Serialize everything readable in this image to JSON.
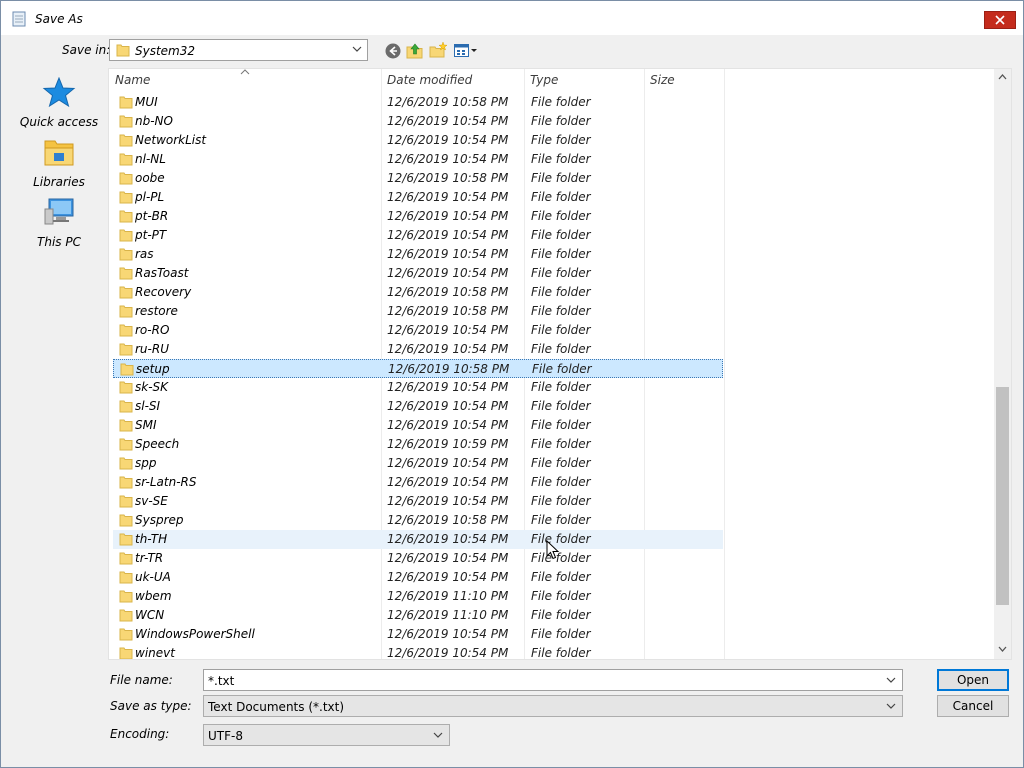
{
  "window": {
    "title": "Save As"
  },
  "save_in": {
    "label": "Save in:",
    "value": "System32"
  },
  "places": [
    {
      "label": "Quick access",
      "icon": "star-icon"
    },
    {
      "label": "Libraries",
      "icon": "libraries-icon"
    },
    {
      "label": "This PC",
      "icon": "computer-icon"
    }
  ],
  "columns": {
    "name": "Name",
    "date": "Date modified",
    "type": "Type",
    "size": "Size"
  },
  "files": [
    {
      "name": "MUI",
      "date": "12/6/2019 10:58 PM",
      "type": "File folder"
    },
    {
      "name": "nb-NO",
      "date": "12/6/2019 10:54 PM",
      "type": "File folder"
    },
    {
      "name": "NetworkList",
      "date": "12/6/2019 10:54 PM",
      "type": "File folder"
    },
    {
      "name": "nl-NL",
      "date": "12/6/2019 10:54 PM",
      "type": "File folder"
    },
    {
      "name": "oobe",
      "date": "12/6/2019 10:58 PM",
      "type": "File folder"
    },
    {
      "name": "pl-PL",
      "date": "12/6/2019 10:54 PM",
      "type": "File folder"
    },
    {
      "name": "pt-BR",
      "date": "12/6/2019 10:54 PM",
      "type": "File folder"
    },
    {
      "name": "pt-PT",
      "date": "12/6/2019 10:54 PM",
      "type": "File folder"
    },
    {
      "name": "ras",
      "date": "12/6/2019 10:54 PM",
      "type": "File folder"
    },
    {
      "name": "RasToast",
      "date": "12/6/2019 10:54 PM",
      "type": "File folder"
    },
    {
      "name": "Recovery",
      "date": "12/6/2019 10:58 PM",
      "type": "File folder"
    },
    {
      "name": "restore",
      "date": "12/6/2019 10:58 PM",
      "type": "File folder"
    },
    {
      "name": "ro-RO",
      "date": "12/6/2019 10:54 PM",
      "type": "File folder"
    },
    {
      "name": "ru-RU",
      "date": "12/6/2019 10:54 PM",
      "type": "File folder"
    },
    {
      "name": "setup",
      "date": "12/6/2019 10:58 PM",
      "type": "File folder"
    },
    {
      "name": "sk-SK",
      "date": "12/6/2019 10:54 PM",
      "type": "File folder"
    },
    {
      "name": "sl-SI",
      "date": "12/6/2019 10:54 PM",
      "type": "File folder"
    },
    {
      "name": "SMI",
      "date": "12/6/2019 10:54 PM",
      "type": "File folder"
    },
    {
      "name": "Speech",
      "date": "12/6/2019 10:59 PM",
      "type": "File folder"
    },
    {
      "name": "spp",
      "date": "12/6/2019 10:54 PM",
      "type": "File folder"
    },
    {
      "name": "sr-Latn-RS",
      "date": "12/6/2019 10:54 PM",
      "type": "File folder"
    },
    {
      "name": "sv-SE",
      "date": "12/6/2019 10:54 PM",
      "type": "File folder"
    },
    {
      "name": "Sysprep",
      "date": "12/6/2019 10:58 PM",
      "type": "File folder"
    },
    {
      "name": "th-TH",
      "date": "12/6/2019 10:54 PM",
      "type": "File folder"
    },
    {
      "name": "tr-TR",
      "date": "12/6/2019 10:54 PM",
      "type": "File folder"
    },
    {
      "name": "uk-UA",
      "date": "12/6/2019 10:54 PM",
      "type": "File folder"
    },
    {
      "name": "wbem",
      "date": "12/6/2019 11:10 PM",
      "type": "File folder"
    },
    {
      "name": "WCN",
      "date": "12/6/2019 11:10 PM",
      "type": "File folder"
    },
    {
      "name": "WindowsPowerShell",
      "date": "12/6/2019 10:54 PM",
      "type": "File folder"
    },
    {
      "name": "winevt",
      "date": "12/6/2019 10:54 PM",
      "type": "File folder"
    }
  ],
  "selected_file": "setup",
  "hovered_file": "th-TH",
  "file_name": {
    "label": "File name:",
    "value": "*.txt"
  },
  "save_as_type": {
    "label": "Save as type:",
    "value": "Text Documents (*.txt)"
  },
  "encoding": {
    "label": "Encoding:",
    "value": "UTF-8"
  },
  "buttons": {
    "open": "Open",
    "cancel": "Cancel"
  },
  "colors": {
    "close": "#c42b1c",
    "selection": "#cce8ff",
    "folder": "#f8d775",
    "accent": "#0078d7"
  }
}
